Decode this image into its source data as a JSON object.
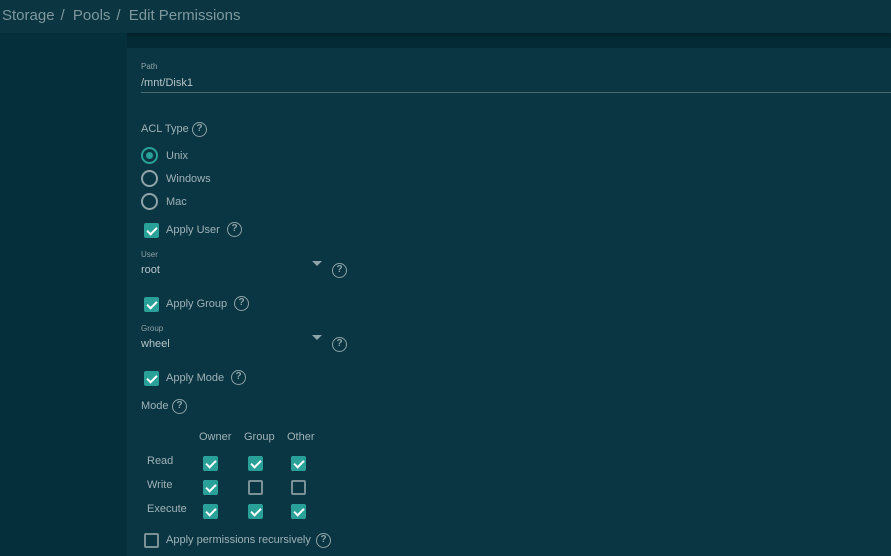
{
  "breadcrumb": [
    "Storage",
    "Pools",
    "Edit Permissions"
  ],
  "path": {
    "label": "Path",
    "value": "/mnt/Disk1"
  },
  "acl": {
    "label": "ACL Type",
    "options": [
      "Unix",
      "Windows",
      "Mac"
    ],
    "selected": "Unix"
  },
  "apply_user": {
    "label": "Apply User",
    "checked": true
  },
  "user": {
    "label": "User",
    "value": "root"
  },
  "apply_group": {
    "label": "Apply Group",
    "checked": true
  },
  "group": {
    "label": "Group",
    "value": "wheel"
  },
  "apply_mode": {
    "label": "Apply Mode",
    "checked": true
  },
  "mode": {
    "label": "Mode",
    "columns": [
      "Owner",
      "Group",
      "Other"
    ],
    "rows": [
      {
        "label": "Read",
        "values": [
          true,
          true,
          true
        ]
      },
      {
        "label": "Write",
        "values": [
          true,
          false,
          false
        ]
      },
      {
        "label": "Execute",
        "values": [
          true,
          true,
          true
        ]
      }
    ]
  },
  "recursive": {
    "label": "Apply permissions recursively",
    "checked": false
  },
  "help_glyph": "?",
  "colors": {
    "accent": "#2aa198",
    "background": "#0a3542"
  }
}
